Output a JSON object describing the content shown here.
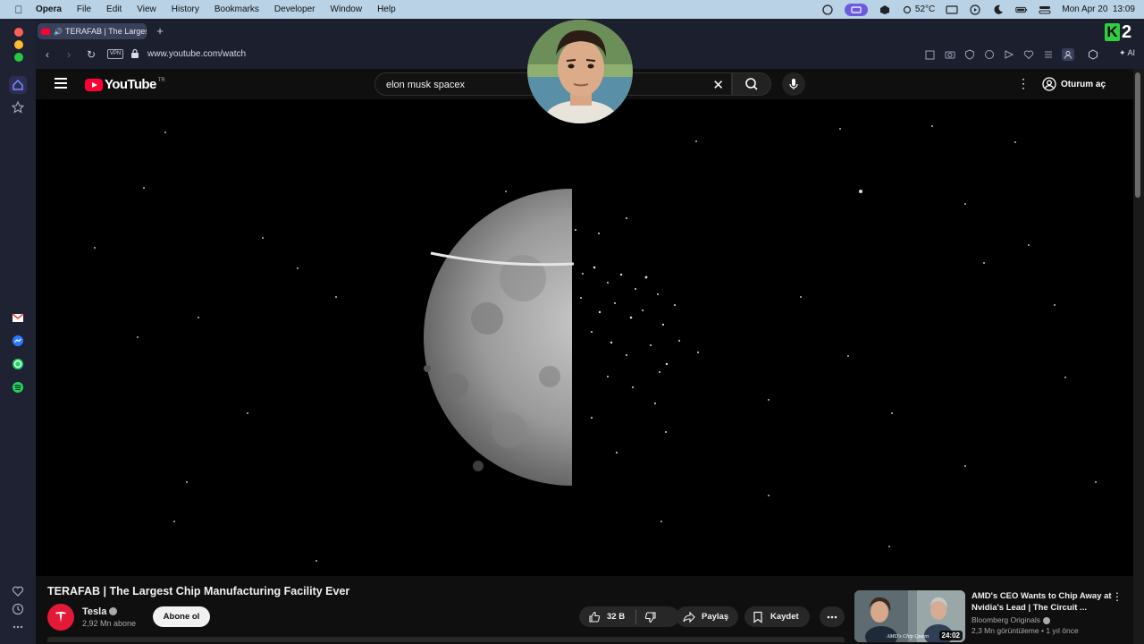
{
  "menubar": {
    "app": "Opera",
    "items": [
      "File",
      "Edit",
      "View",
      "History",
      "Bookmarks",
      "Developer",
      "Window",
      "Help"
    ],
    "temperature": "52°C",
    "datetime": "Mon Apr 20  13:09"
  },
  "browser": {
    "tab_title": "TERAFAB | The Largest",
    "vpn_label": "VPN",
    "url": "www.youtube.com/watch",
    "ai_label": "AI",
    "overlay_logo_k": "K",
    "overlay_logo_2": "2"
  },
  "youtube": {
    "logo_text": "YouTube",
    "region": "TR",
    "search_query": "elon musk spacex",
    "sign_in": "Oturum aç"
  },
  "video": {
    "title": "TERAFAB | The Largest Chip Manufacturing Facility Ever",
    "channel": "Tesla",
    "subscribers": "2,92 Mn abone",
    "subscribe_label": "Abone ol",
    "likes": "32 B",
    "share_label": "Paylaş",
    "save_label": "Kaydet"
  },
  "recommendation": {
    "title": "AMD's CEO Wants to Chip Away at Nvidia's Lead | The Circuit ...",
    "channel": "Bloomberg Originals",
    "views": "2,3 Mn görüntüleme",
    "age": "1 yıl önce",
    "duration": "24:02",
    "thumb_caption": "AMD's Chip Queen"
  },
  "colors": {
    "youtube_red": "#ff0033",
    "opera_sidebar": "#1f2233",
    "tesla_red": "#e31937",
    "k2_green": "#2fcf3f"
  }
}
